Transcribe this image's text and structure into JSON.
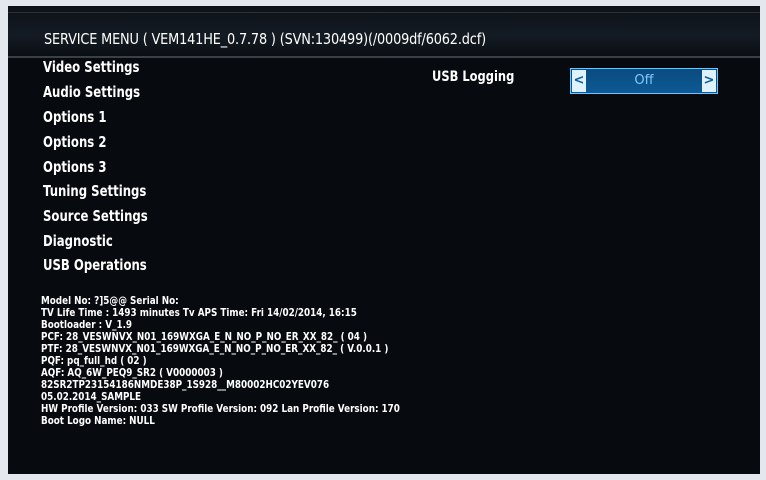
{
  "header": {
    "title": "SERVICE MENU ( VEM141HE_0.7.78 ) (SVN:130499)(/0009df/6062.dcf)"
  },
  "menu": {
    "items": [
      "Video Settings",
      "Audio Settings",
      "Options 1",
      "Options 2",
      "Options 3",
      "Tuning Settings",
      "Source Settings",
      "Diagnostic",
      "USB Operations"
    ]
  },
  "setting": {
    "label": "USB Logging",
    "value": "Off",
    "left_arrow": "<",
    "right_arrow": ">"
  },
  "info": {
    "lines": [
      "Model No: ?]5@@   Serial No:",
      "TV Life Time : 1493 minutes  Tv APS Time: Fri 14/02/2014, 16:15",
      "Bootloader : V_1.9",
      "PCF: 28_VESWNVX_N01_169WXGA_E_N_NO_P_NO_ER_XX_82_ ( 04 )",
      "PTF: 28_VESWNVX_N01_169WXGA_E_N_NO_P_NO_ER_XX_82_ ( V.0.0.1 )",
      "PQF: pq_full_hd ( 02 )",
      "AQF: AQ_6W_PEQ9_SR2        ( V0000003 )",
      "82SR2TP23154186NMDE38P_1S928__M80002HC02YEV076",
      "05.02.2014_SAMPLE",
      "HW Profile Version: 033  SW Profile Version: 092  Lan Profile Version: 170",
      "Boot Logo Name: NULL"
    ]
  },
  "colors": {
    "background": "#070a0f",
    "text": "#ffffff",
    "selector_fill": "#0d5a96",
    "selector_border": "#6fc3ff",
    "selector_text": "#7fc9ff"
  }
}
